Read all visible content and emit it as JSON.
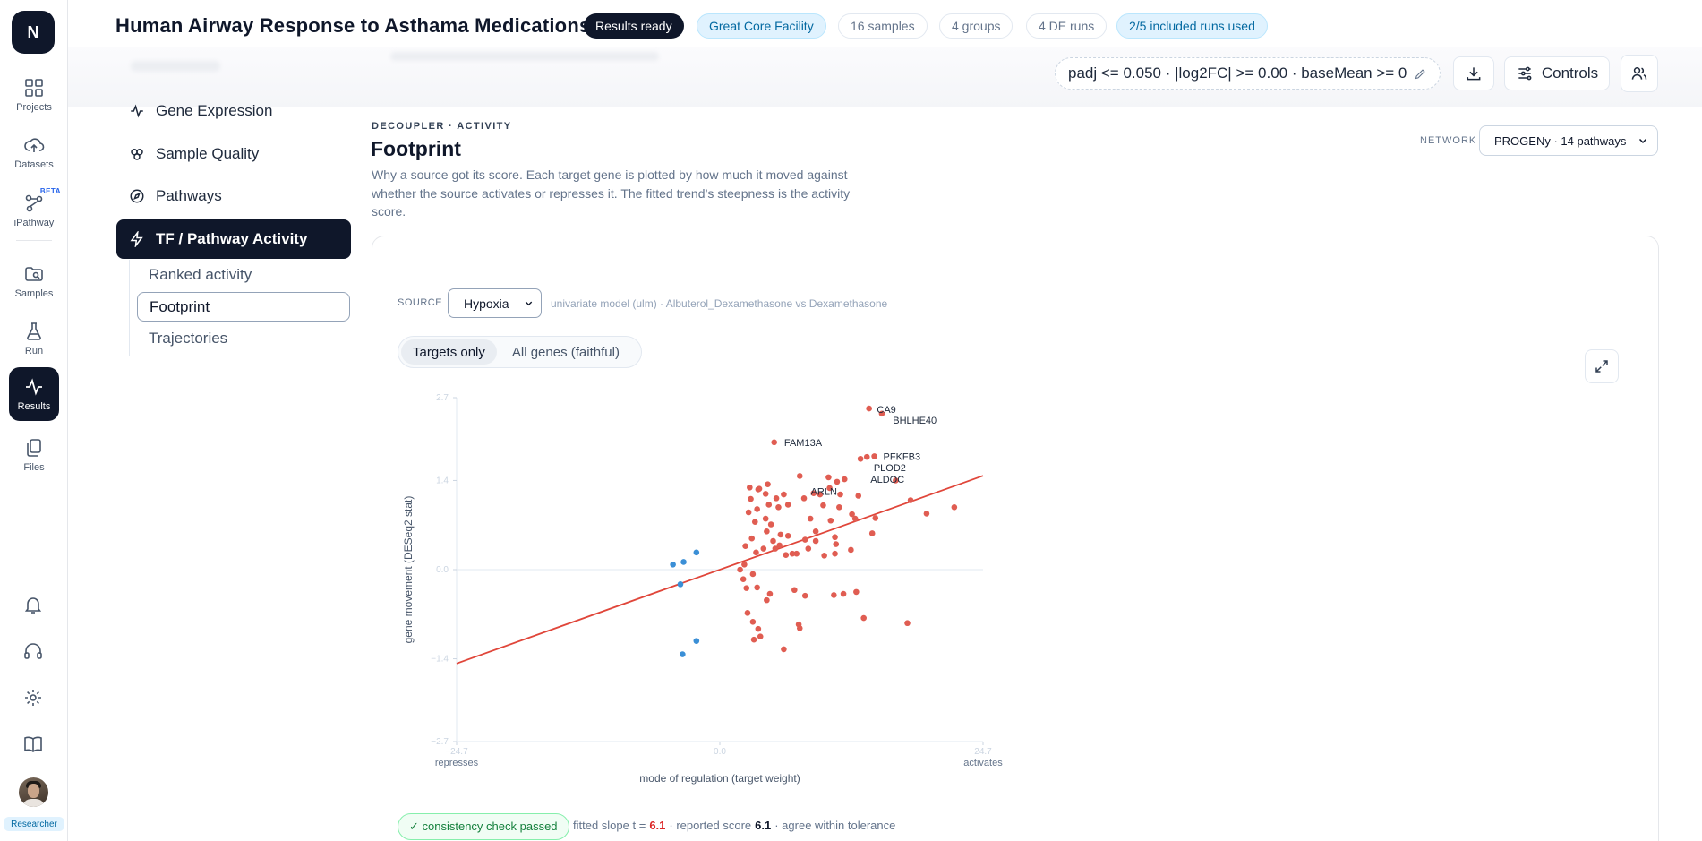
{
  "app": {
    "logo_letter": "N"
  },
  "rail": {
    "items": [
      {
        "label": "Projects",
        "icon": "grid-icon"
      },
      {
        "label": "Datasets",
        "icon": "cloud-upload-icon"
      },
      {
        "label": "iPathway",
        "icon": "pathway-icon",
        "badge": "BETA"
      },
      {
        "label": "Samples",
        "icon": "folder-search-icon"
      },
      {
        "label": "Run",
        "icon": "flask-icon"
      },
      {
        "label": "Results",
        "icon": "pulse-icon",
        "active": true
      },
      {
        "label": "Files",
        "icon": "files-icon"
      }
    ],
    "role": "Researcher"
  },
  "header": {
    "title": "Human Airway Response to Asthama Medications",
    "status": "Results ready",
    "facility": "Great Core Facility",
    "samples": "16 samples",
    "groups": "4 groups",
    "de_runs": "4 DE runs",
    "runs_used": "2/5 included runs used"
  },
  "toolbar": {
    "filter": "padj <= 0.050 · |log2FC| >= 0.00 · baseMean >= 0",
    "controls_label": "Controls"
  },
  "nav": {
    "items": [
      {
        "label": "Gene Expression",
        "icon": "pulse-icon"
      },
      {
        "label": "Sample Quality",
        "icon": "cells-icon"
      },
      {
        "label": "Pathways",
        "icon": "compass-icon"
      },
      {
        "label": "TF / Pathway Activity",
        "icon": "bolt-icon",
        "active": true
      }
    ],
    "sub_items": [
      {
        "label": "Ranked activity"
      },
      {
        "label": "Footprint",
        "active": true
      },
      {
        "label": "Trajectories"
      }
    ]
  },
  "main": {
    "eyebrow": "DECOUPLER · ACTIVITY",
    "title": "Footprint",
    "description": "Why a source got its score. Each target gene is plotted by how much it moved against whether the source activates or represses it. The fitted trend’s steepness is the activity score.",
    "network_label": "NETWORK",
    "network_value": "PROGENy · 14 pathways",
    "source_label": "SOURCE",
    "source_value": "Hypoxia",
    "source_note": "univariate model (ulm) · Albuterol_Dexamethasone vs Dexamethasone",
    "toggle": [
      "Targets only",
      "All genes (faithful)"
    ],
    "consistency_badge": "✓ consistency check passed",
    "consistency": {
      "prefix": "fitted slope t =",
      "slope": "6.1",
      "mid": "· reported score",
      "score": "6.1",
      "suffix": "· agree within tolerance"
    }
  },
  "colors": {
    "positive": "#e05d52",
    "negative": "#3b8fd6",
    "trend": "#e0463a",
    "accent_dark": "#0f172a"
  },
  "chart_data": {
    "type": "scatter",
    "xlabel": "mode of regulation (target weight)",
    "ylabel": "gene movement (DESeq2 stat)",
    "x_ticks": [
      "−24.7",
      "0.0",
      "24.7"
    ],
    "y_ticks": [
      "2.7",
      "1.4",
      "0.0",
      "−1.4",
      "−2.7"
    ],
    "x_end_labels": {
      "left": "represses",
      "right": "activates"
    },
    "xlim": [
      -24.7,
      24.7
    ],
    "ylim": [
      -2.7,
      2.7
    ],
    "trend": {
      "slope": 0.0455,
      "intercept": 0
    },
    "labels": [
      {
        "gene": "CA9",
        "x": 14.4,
        "y": 2.52
      },
      {
        "gene": "BHLHE40",
        "x": 15.9,
        "y": 2.35
      },
      {
        "gene": "FAM13A",
        "x": 5.7,
        "y": 2.0
      },
      {
        "gene": "PFKFB3",
        "x": 15.0,
        "y": 1.78
      },
      {
        "gene": "PLOD2",
        "x": 14.1,
        "y": 1.6
      },
      {
        "gene": "ALDOC",
        "x": 13.8,
        "y": 1.42
      },
      {
        "gene": "ARLN",
        "x": 8.2,
        "y": 1.23
      }
    ],
    "points_positive": [
      [
        14.0,
        2.53
      ],
      [
        15.2,
        2.45
      ],
      [
        5.1,
        2.0
      ],
      [
        13.2,
        1.74
      ],
      [
        13.8,
        1.77
      ],
      [
        14.5,
        1.78
      ],
      [
        16.5,
        1.4
      ],
      [
        2.8,
        1.29
      ],
      [
        3.7,
        1.27
      ],
      [
        4.5,
        1.34
      ],
      [
        7.5,
        1.47
      ],
      [
        10.2,
        1.45
      ],
      [
        11.0,
        1.38
      ],
      [
        11.7,
        1.42
      ],
      [
        2.9,
        1.11
      ],
      [
        3.6,
        1.26
      ],
      [
        4.3,
        1.19
      ],
      [
        5.3,
        1.12
      ],
      [
        6.0,
        1.18
      ],
      [
        8.8,
        1.2
      ],
      [
        9.4,
        1.18
      ],
      [
        10.3,
        1.28
      ],
      [
        11.3,
        1.18
      ],
      [
        13.0,
        1.16
      ],
      [
        2.7,
        0.9
      ],
      [
        3.5,
        0.95
      ],
      [
        4.6,
        1.02
      ],
      [
        5.5,
        0.98
      ],
      [
        6.4,
        1.02
      ],
      [
        7.9,
        1.12
      ],
      [
        9.7,
        1.01
      ],
      [
        11.2,
        0.98
      ],
      [
        12.4,
        0.87
      ],
      [
        17.9,
        1.09
      ],
      [
        19.4,
        0.88
      ],
      [
        22.0,
        0.98
      ],
      [
        4.3,
        0.8
      ],
      [
        4.8,
        0.71
      ],
      [
        3.3,
        0.75
      ],
      [
        5.7,
        0.55
      ],
      [
        8.5,
        0.8
      ],
      [
        9.0,
        0.6
      ],
      [
        10.4,
        0.77
      ],
      [
        14.3,
        0.57
      ],
      [
        10.8,
        0.51
      ],
      [
        2.4,
        0.37
      ],
      [
        3.0,
        0.49
      ],
      [
        4.4,
        0.6
      ],
      [
        5.0,
        0.45
      ],
      [
        5.6,
        0.38
      ],
      [
        6.4,
        0.53
      ],
      [
        8.0,
        0.47
      ],
      [
        9.0,
        0.45
      ],
      [
        10.9,
        0.4
      ],
      [
        12.7,
        0.8
      ],
      [
        14.6,
        0.81
      ],
      [
        3.4,
        0.27
      ],
      [
        4.1,
        0.33
      ],
      [
        5.2,
        0.33
      ],
      [
        6.2,
        0.23
      ],
      [
        6.8,
        0.25
      ],
      [
        7.2,
        0.25
      ],
      [
        8.3,
        0.33
      ],
      [
        9.8,
        0.22
      ],
      [
        10.8,
        0.25
      ],
      [
        12.3,
        0.31
      ],
      [
        1.9,
        0.0
      ],
      [
        2.3,
        0.08
      ],
      [
        3.1,
        -0.07
      ],
      [
        2.2,
        -0.15
      ],
      [
        2.5,
        -0.29
      ],
      [
        3.5,
        -0.28
      ],
      [
        4.4,
        -0.48
      ],
      [
        4.7,
        -0.38
      ],
      [
        7.0,
        -0.32
      ],
      [
        8.0,
        -0.41
      ],
      [
        10.7,
        -0.4
      ],
      [
        11.6,
        -0.38
      ],
      [
        12.8,
        -0.35
      ],
      [
        2.6,
        -0.68
      ],
      [
        3.1,
        -0.82
      ],
      [
        3.6,
        -0.93
      ],
      [
        3.2,
        -1.1
      ],
      [
        3.8,
        -1.05
      ],
      [
        6.0,
        -1.25
      ],
      [
        7.4,
        -0.86
      ],
      [
        7.5,
        -0.92
      ],
      [
        13.5,
        -0.76
      ],
      [
        17.6,
        -0.84
      ]
    ],
    "points_negative": [
      [
        -2.2,
        0.27
      ],
      [
        -3.4,
        0.12
      ],
      [
        -4.4,
        0.08
      ],
      [
        -3.7,
        -0.23
      ],
      [
        -2.2,
        -1.12
      ],
      [
        -3.5,
        -1.33
      ]
    ]
  }
}
